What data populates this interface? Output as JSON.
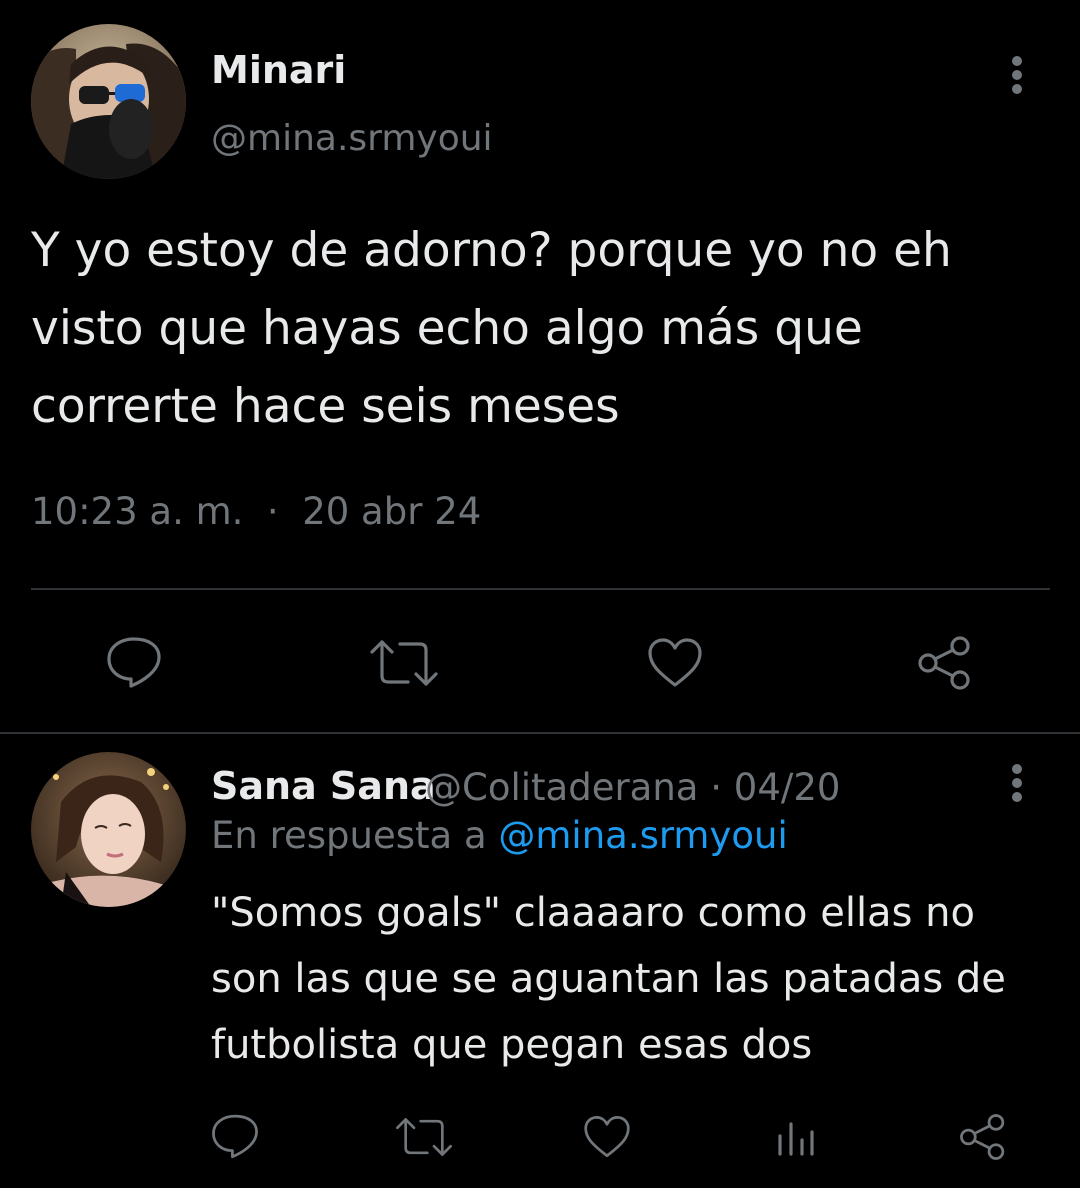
{
  "main_tweet": {
    "author_name": "Minari",
    "author_handle": "@mina.srmyoui",
    "text": "Y yo estoy de adorno? porque yo no eh visto que hayas echo algo más que correrte hace seis meses",
    "time": "10:23 a. m.",
    "separator": "·",
    "date": "20 abr 24",
    "actions": [
      "reply-icon",
      "retweet-icon",
      "like-icon",
      "share-icon"
    ]
  },
  "reply_tweet": {
    "author_name": "Sana Sana",
    "author_handle": "@Colitaderana",
    "separator": "·",
    "date": "04/20",
    "reply_prefix": "En respuesta a",
    "reply_mention": "@mina.srmyoui",
    "text": "\"Somos goals\" claaaaro como ellas no son las que se aguantan las patadas de futbolista que pegan esas dos",
    "actions": [
      "reply-icon",
      "retweet-icon",
      "like-icon",
      "views-icon",
      "share-icon"
    ]
  },
  "colors": {
    "background": "#000000",
    "text_primary": "#e7e9ea",
    "text_secondary": "#71767b",
    "accent": "#1d9bf0",
    "divider": "#2f3336"
  }
}
